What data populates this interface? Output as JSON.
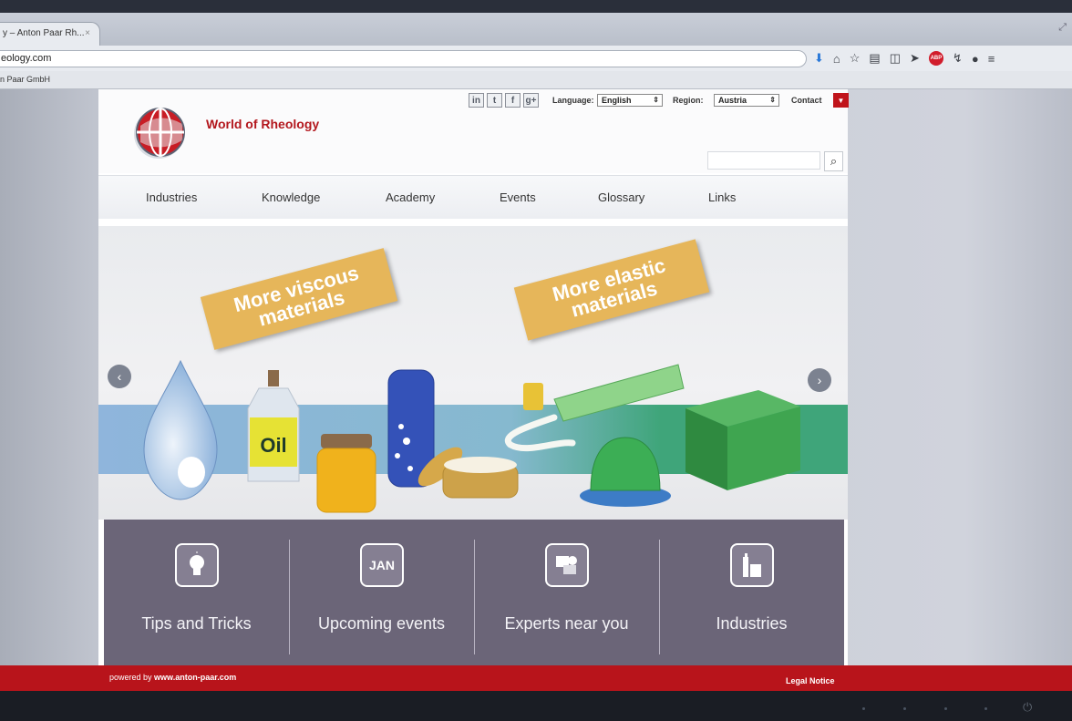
{
  "browser": {
    "tab_title": "y – Anton Paar Rh...",
    "tab_close": "×",
    "url": "eology.com",
    "bookmark": "n Paar GmbH",
    "toolbar_icons": [
      "download-icon",
      "home-icon",
      "star-icon",
      "reading-list-icon",
      "pocket-icon",
      "send-icon",
      "adblock-icon",
      "extension-icon",
      "chat-icon",
      "menu-icon"
    ],
    "abp_label": "ABP"
  },
  "site": {
    "title": "World of Rheology",
    "social": [
      "in",
      "t",
      "f",
      "g+"
    ],
    "language_label": "Language:",
    "language_value": "English",
    "region_label": "Region:",
    "region_value": "Austria",
    "contact": "Contact"
  },
  "nav": {
    "items": [
      "Industries",
      "Knowledge",
      "Academy",
      "Events",
      "Glossary",
      "Links"
    ]
  },
  "hero": {
    "sign_viscous": "More viscous materials",
    "sign_elastic": "More elastic materials",
    "bottle_label": "Oil",
    "accent_colors": {
      "sign": "#e6b65a",
      "band_blue": "#8fb5dc",
      "band_green": "#3fa57a"
    }
  },
  "features": [
    {
      "label": "Tips and Tricks",
      "icon": "lightbulb-icon"
    },
    {
      "label": "Upcoming events",
      "icon": "calendar-icon",
      "icon_text": "JAN"
    },
    {
      "label": "Experts near you",
      "icon": "map-pin-icon"
    },
    {
      "label": "Industries",
      "icon": "factory-icon"
    }
  ],
  "footer": {
    "powered_prefix": "powered by ",
    "powered_link": "www.anton-paar.com",
    "legal": "Legal Notice"
  },
  "colors": {
    "brand_red": "#b3171d",
    "feature_bg": "#6b6578"
  }
}
